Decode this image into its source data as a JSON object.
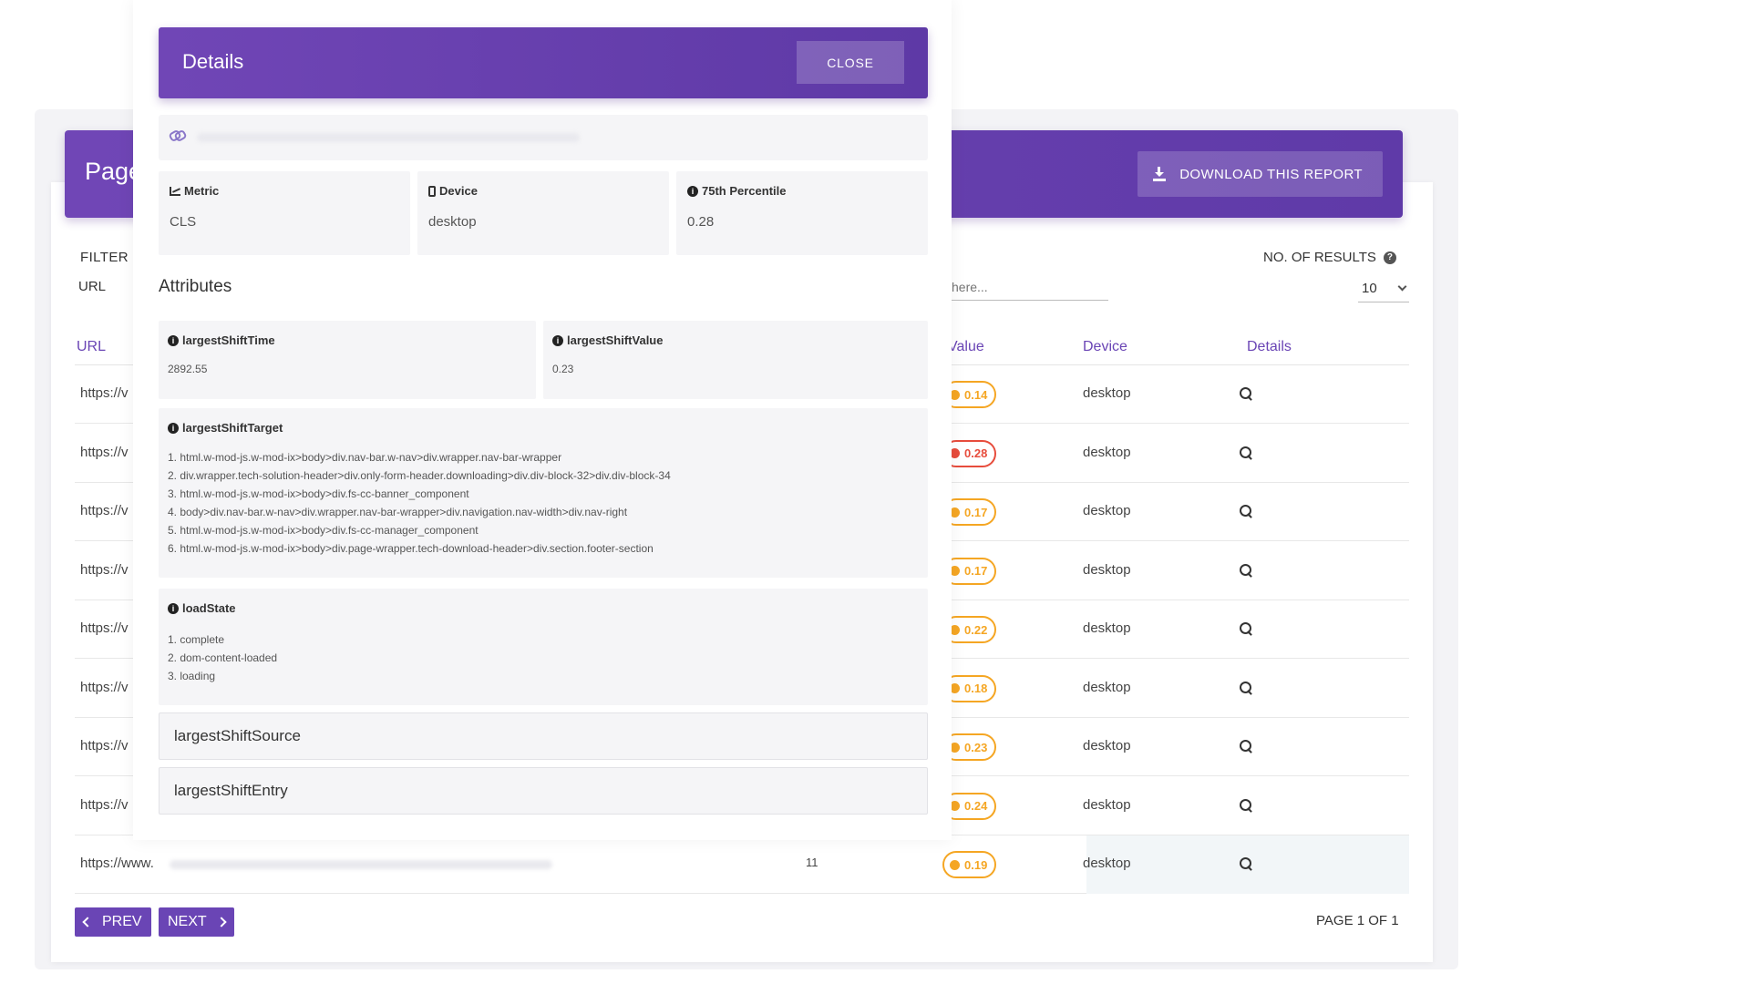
{
  "report": {
    "title": "Page",
    "download_label": "DOWNLOAD THIS REPORT",
    "filter_label": "FILTER",
    "filter_field": "URL",
    "search_placeholder": "here...",
    "results_label": "NO. OF RESULTS",
    "results_value": "10",
    "columns": {
      "url": "URL",
      "value": "Value",
      "device": "Device",
      "details": "Details"
    },
    "rows": [
      {
        "url": "https://v",
        "score": "0.14",
        "device": "desktop",
        "status": "warn"
      },
      {
        "url": "https://v",
        "score": "0.28",
        "device": "desktop",
        "status": "bad"
      },
      {
        "url": "https://v",
        "score": "0.17",
        "device": "desktop",
        "status": "warn"
      },
      {
        "url": "https://v",
        "score": "0.17",
        "device": "desktop",
        "status": "warn"
      },
      {
        "url": "https://v",
        "score": "0.22",
        "device": "desktop",
        "status": "warn"
      },
      {
        "url": "https://v",
        "score": "0.18",
        "device": "desktop",
        "status": "warn"
      },
      {
        "url": "https://v",
        "score": "0.23",
        "device": "desktop",
        "status": "warn"
      },
      {
        "url": "https://v",
        "score": "0.24",
        "device": "desktop",
        "status": "warn"
      },
      {
        "url": "https://www.",
        "count": "11",
        "score": "0.19",
        "device": "desktop",
        "status": "warn"
      }
    ],
    "prev_label": "PREV",
    "next_label": "NEXT",
    "page_info": "PAGE 1 OF 1"
  },
  "modal": {
    "title": "Details",
    "close_label": "CLOSE",
    "metric": {
      "label": "Metric",
      "value": "CLS"
    },
    "device": {
      "label": "Device",
      "value": "desktop"
    },
    "percentile": {
      "label": "75th Percentile",
      "value": "0.28"
    },
    "attributes_heading": "Attributes",
    "largestShiftTime": {
      "label": "largestShiftTime",
      "value": "2892.55"
    },
    "largestShiftValue": {
      "label": "largestShiftValue",
      "value": "0.23"
    },
    "largestShiftTarget": {
      "label": "largestShiftTarget",
      "items": [
        "1. html.w-mod-js.w-mod-ix>body>div.nav-bar.w-nav>div.wrapper.nav-bar-wrapper",
        "2. div.wrapper.tech-solution-header>div.only-form-header.downloading>div.div-block-32>div.div-block-34",
        "3. html.w-mod-js.w-mod-ix>body>div.fs-cc-banner_component",
        "4. body>div.nav-bar.w-nav>div.wrapper.nav-bar-wrapper>div.navigation.nav-width>div.nav-right",
        "5. html.w-mod-js.w-mod-ix>body>div.fs-cc-manager_component",
        "6. html.w-mod-js.w-mod-ix>body>div.page-wrapper.tech-download-header>div.section.footer-section"
      ]
    },
    "loadState": {
      "label": "loadState",
      "items": [
        "1. complete",
        "2. dom-content-loaded",
        "3. loading"
      ]
    },
    "largestShiftSource": "largestShiftSource",
    "largestShiftEntry": "largestShiftEntry"
  },
  "colors": {
    "brand": "#6a45b5",
    "warn": "#f5a623",
    "bad": "#e74c3c"
  }
}
